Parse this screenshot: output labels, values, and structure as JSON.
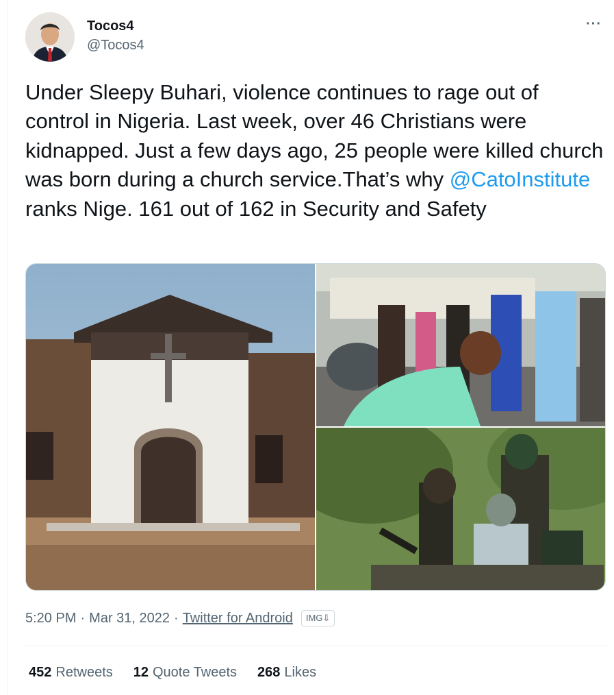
{
  "author": {
    "display_name": "Tocos4",
    "handle": "@Tocos4",
    "avatar_icon": "user-avatar-icon"
  },
  "more_icon": "···",
  "tweet": {
    "text_before": "Under Sleepy Buhari, violence continues to rage out of control in Nigeria. Last week, over 46 Christians were kidnapped. Just a few days ago, 25 people were killed church was born during a church service.That’s why ",
    "mention": "@CatoInstitute",
    "text_after": " ranks Nige. 161 out of 162 in Security and Safety"
  },
  "media": {
    "images": [
      {
        "name": "burned-church-photo"
      },
      {
        "name": "grieving-crowd-photo"
      },
      {
        "name": "armed-men-vehicle-photo"
      }
    ]
  },
  "meta": {
    "time": "5:20 PM",
    "sep1": "·",
    "date": "Mar 31, 2022",
    "sep2": "·",
    "source": "Twitter for Android",
    "badge": "IMG⇩"
  },
  "stats": {
    "retweets_count": "452",
    "retweets_label": "Retweets",
    "quotes_count": "12",
    "quotes_label": "Quote Tweets",
    "likes_count": "268",
    "likes_label": "Likes"
  },
  "colors": {
    "link": "#1d9bf0",
    "secondary_text": "#536471",
    "primary_text": "#0f1419",
    "border": "#cfd9de"
  }
}
